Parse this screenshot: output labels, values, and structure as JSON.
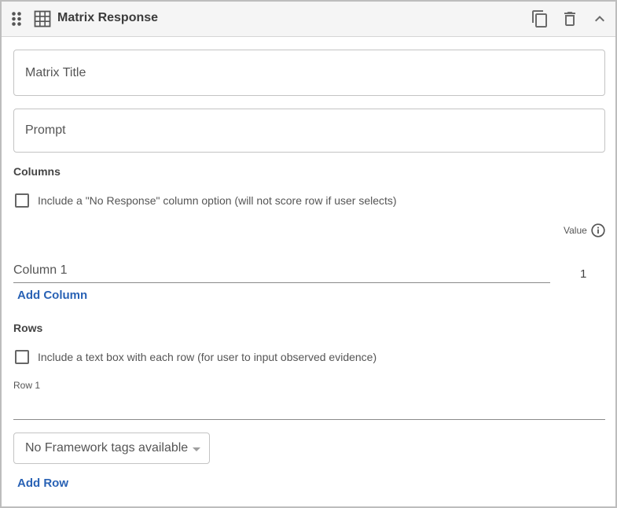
{
  "header": {
    "title": "Matrix Response",
    "icons": [
      "drag-handle-icon",
      "grid-icon",
      "copy-icon",
      "delete-icon",
      "chevron-up-icon"
    ]
  },
  "fields": {
    "matrix_title_placeholder": "Matrix Title",
    "prompt_placeholder": "Prompt"
  },
  "columns": {
    "section_label": "Columns",
    "no_response_checkbox": {
      "label": "Include a \"No Response\" column option (will not score row if user selects)",
      "checked": false
    },
    "value_header": "Value",
    "items": [
      {
        "label": "Column 1",
        "value": "1"
      }
    ],
    "add_label": "Add Column"
  },
  "rows": {
    "section_label": "Rows",
    "text_box_checkbox": {
      "label": "Include a text box with each row (for user to input observed evidence)",
      "checked": false
    },
    "items": [
      {
        "label": "Row 1",
        "value": ""
      }
    ],
    "framework_select": "No Framework tags available",
    "add_label": "Add Row"
  },
  "colors": {
    "accent": "#2962b5",
    "header_bg": "#f5f5f5",
    "border": "#bdbdbd"
  }
}
